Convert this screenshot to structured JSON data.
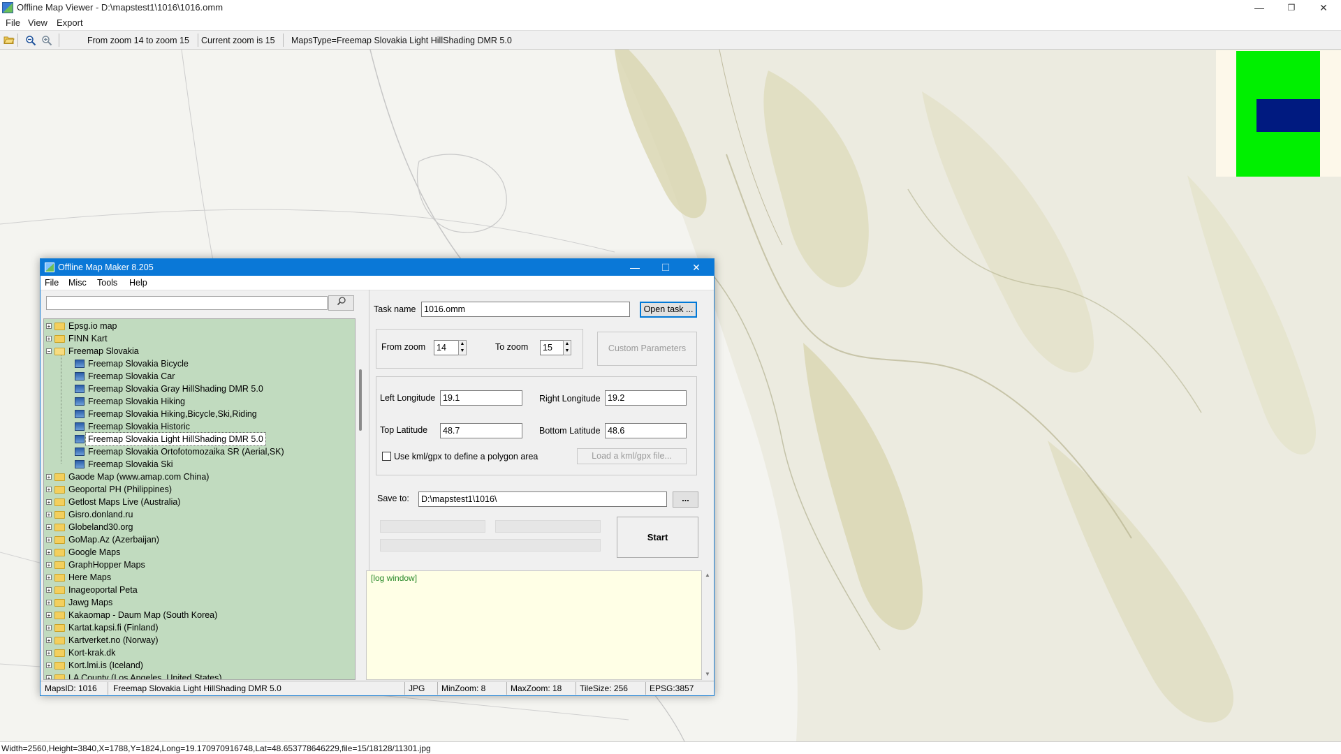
{
  "window": {
    "title": "Offline Map Viewer - D:\\mapstest1\\1016\\1016.omm",
    "minimize": "—",
    "restore": "❐",
    "close": "✕"
  },
  "menu": [
    "File",
    "View",
    "Export"
  ],
  "toolbar": {
    "open_icon": "folder-open-icon",
    "zoom_out_icon": "zoom-out-icon",
    "zoom_in_icon": "zoom-in-icon",
    "zoom_range": "From zoom 14 to zoom 15",
    "current_zoom": "Current zoom is 15",
    "maps_type": "MapsType=Freemap Slovakia Light HillShading DMR 5.0"
  },
  "status": "Width=2560,Height=3840,X=1788,Y=1824,Long=19.170970916748,Lat=48.653778646229,file=15/18128/11301.jpg",
  "colors": {
    "accent": "#0a78d7",
    "tree_bg": "#c1dbbf",
    "log_bg": "#ffffe6",
    "minimap_green": "#00f000",
    "minimap_blue": "#001a80"
  },
  "dialog": {
    "title": "Offline Map Maker 8.205",
    "minimize": "—",
    "maximize": "☐",
    "close": "✕",
    "menu": [
      "File",
      "Misc",
      "Tools",
      "Help"
    ],
    "search": {
      "value": "",
      "button_icon": "magnifier-icon"
    },
    "tree": [
      {
        "label": "Epsg.io map",
        "type": "folder",
        "level": 0,
        "expander": "+"
      },
      {
        "label": "FINN Kart",
        "type": "folder",
        "level": 0,
        "expander": "+"
      },
      {
        "label": "Freemap Slovakia",
        "type": "folder-open",
        "level": 0,
        "expander": "−"
      },
      {
        "label": "Freemap Slovakia Bicycle",
        "type": "map",
        "level": 1
      },
      {
        "label": "Freemap Slovakia Car",
        "type": "map",
        "level": 1
      },
      {
        "label": "Freemap Slovakia Gray HillShading DMR 5.0",
        "type": "map",
        "level": 1
      },
      {
        "label": "Freemap Slovakia Hiking",
        "type": "map",
        "level": 1
      },
      {
        "label": "Freemap Slovakia Hiking,Bicycle,Ski,Riding",
        "type": "map",
        "level": 1
      },
      {
        "label": "Freemap Slovakia Historic",
        "type": "map",
        "level": 1
      },
      {
        "label": "Freemap Slovakia Light HillShading DMR 5.0",
        "type": "map",
        "level": 1,
        "selected": true
      },
      {
        "label": "Freemap Slovakia Ortofotomozaika SR (Aerial,SK)",
        "type": "map",
        "level": 1
      },
      {
        "label": "Freemap Slovakia Ski",
        "type": "map",
        "level": 1
      },
      {
        "label": "Gaode Map (www.amap.com China)",
        "type": "folder",
        "level": 0,
        "expander": "+"
      },
      {
        "label": "Geoportal PH (Philippines)",
        "type": "folder",
        "level": 0,
        "expander": "+"
      },
      {
        "label": "Getlost Maps Live (Australia)",
        "type": "folder",
        "level": 0,
        "expander": "+"
      },
      {
        "label": "Gisro.donland.ru",
        "type": "folder",
        "level": 0,
        "expander": "+"
      },
      {
        "label": "Globeland30.org",
        "type": "folder",
        "level": 0,
        "expander": "+"
      },
      {
        "label": "GoMap.Az (Azerbaijan)",
        "type": "folder",
        "level": 0,
        "expander": "+"
      },
      {
        "label": "Google Maps",
        "type": "folder",
        "level": 0,
        "expander": "+"
      },
      {
        "label": "GraphHopper Maps",
        "type": "folder",
        "level": 0,
        "expander": "+"
      },
      {
        "label": "Here Maps",
        "type": "folder",
        "level": 0,
        "expander": "+"
      },
      {
        "label": "Inageoportal Peta",
        "type": "folder",
        "level": 0,
        "expander": "+"
      },
      {
        "label": "Jawg Maps",
        "type": "folder",
        "level": 0,
        "expander": "+"
      },
      {
        "label": "Kakaomap - Daum Map (South Korea)",
        "type": "folder",
        "level": 0,
        "expander": "+"
      },
      {
        "label": "Kartat.kapsi.fi (Finland)",
        "type": "folder",
        "level": 0,
        "expander": "+"
      },
      {
        "label": "Kartverket.no (Norway)",
        "type": "folder",
        "level": 0,
        "expander": "+"
      },
      {
        "label": "Kort-krak.dk",
        "type": "folder",
        "level": 0,
        "expander": "+"
      },
      {
        "label": "Kort.lmi.is (Iceland)",
        "type": "folder",
        "level": 0,
        "expander": "+"
      },
      {
        "label": "LA County (Los Angeles, United States)",
        "type": "folder",
        "level": 0,
        "expander": "+"
      }
    ],
    "form": {
      "task_name_label": "Task name",
      "task_name_value": "1016.omm",
      "open_task": "Open task ...",
      "from_zoom_label": "From zoom",
      "from_zoom_value": "14",
      "to_zoom_label": "To zoom",
      "to_zoom_value": "15",
      "custom_params": "Custom Parameters",
      "left_lon_label": "Left Longitude",
      "left_lon_value": "19.1",
      "right_lon_label": "Right Longitude",
      "right_lon_value": "19.2",
      "top_lat_label": "Top Latitude",
      "top_lat_value": "48.7",
      "bottom_lat_label": "Bottom Latitude",
      "bottom_lat_value": "48.6",
      "kml_checkbox_label": "Use kml/gpx to define a polygon area",
      "kml_checked": false,
      "load_kml": "Load a kml/gpx file...",
      "save_to_label": "Save to:",
      "save_to_value": "D:\\mapstest1\\1016\\",
      "browse": "...",
      "start": "Start",
      "progress": [
        0,
        0,
        0
      ]
    },
    "log": "[log window]",
    "status": {
      "maps_id": "MapsID: 1016",
      "map_name": "Freemap Slovakia Light HillShading DMR 5.0",
      "format": "JPG",
      "min_zoom": "MinZoom: 8",
      "max_zoom": "MaxZoom: 18",
      "tile_size": "TileSize: 256",
      "epsg": "EPSG:3857"
    }
  }
}
